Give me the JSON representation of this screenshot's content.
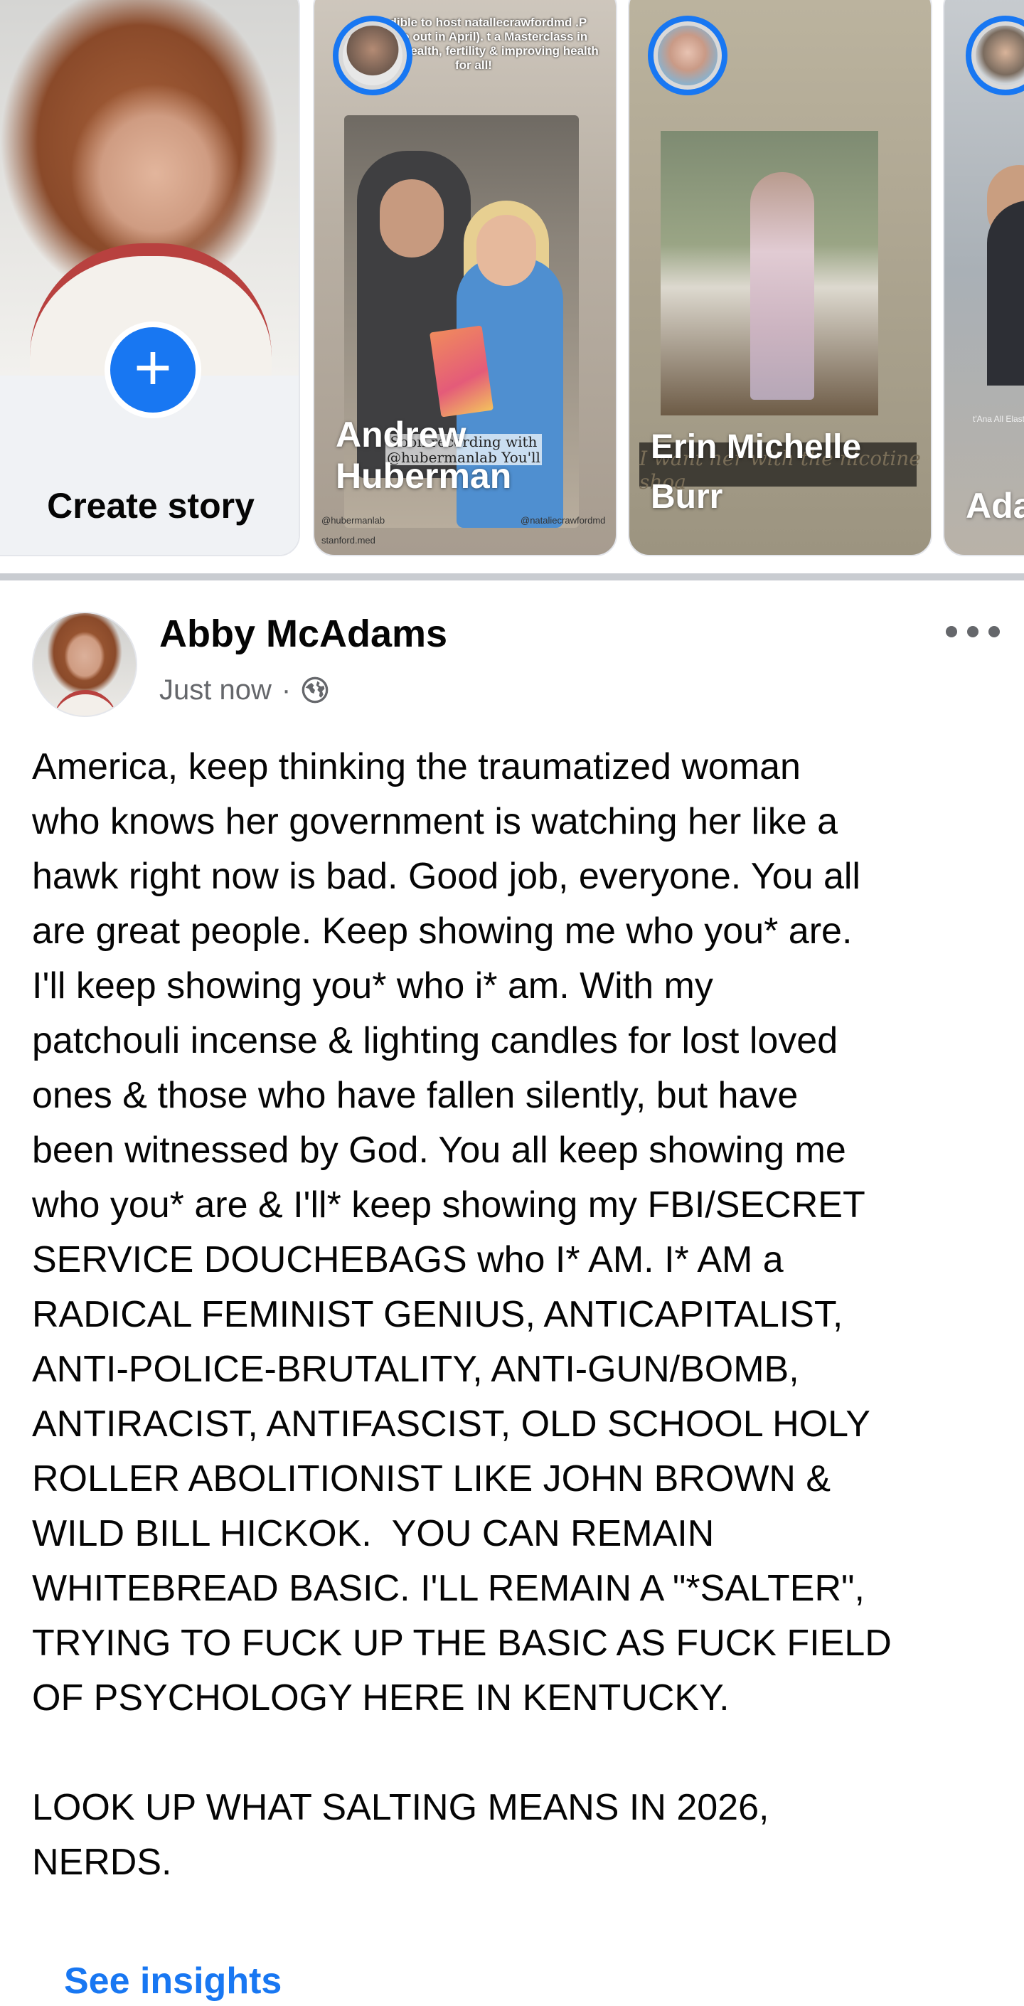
{
  "stories": {
    "create": {
      "label": "Create story",
      "icon": "plus-icon"
    },
    "items": [
      {
        "name": "Andrew Huberman",
        "caption": "Incredible to host natallecrawfordmd .P (episode out in April). t a Masterclass in women's health, fertility & improving health for all!",
        "overlay_text": "Soon recording with @hubermanlab",
        "overlay_text_2": "You'll",
        "handle_left": "@hubermanlab",
        "handle_right": "@nataliecrawfordmd",
        "handle_bottom": "stanford.med"
      },
      {
        "name": "Erin Michelle Burr",
        "mirror_text": "I want her with the nicotine shoa"
      },
      {
        "name": "Ada",
        "note": "t'Ana All Elasticy"
      }
    ]
  },
  "post": {
    "author": "Abby McAdams",
    "timestamp": "Just now",
    "separator": "·",
    "privacy_icon": "globe-icon",
    "more_icon": "more-options-icon",
    "lines": [
      "America, keep thinking the traumatized woman",
      "who knows her government is watching her like a",
      "hawk right now is bad. Good job, everyone. You all",
      "are great people. Keep showing me who you* are.",
      "I'll keep showing you* who i* am. With my",
      "patchouli incense & lighting candles for lost loved",
      "ones & those who have fallen silently, but have",
      "been witnessed by God. You all keep showing me",
      "who you* are & I'll* keep showing my FBI/SECRET",
      "SERVICE DOUCHEBAGS who I* AM. I* AM a",
      "RADICAL FEMINIST GENIUS, ANTICAPITALIST,",
      "ANTI-POLICE-BRUTALITY, ANTI-GUN/BOMB,",
      "ANTIRACIST, ANTIFASCIST, OLD SCHOOL HOLY",
      "ROLLER ABOLITIONIST LIKE JOHN BROWN &",
      "WILD BILL HICKOK.  YOU CAN REMAIN",
      "WHITEBREAD BASIC. I'LL REMAIN A \"*SALTER\",",
      "TRYING TO FUCK UP THE BASIC AS FUCK FIELD",
      "OF PSYCHOLOGY HERE IN KENTUCKY."
    ],
    "lines_2": [
      "LOOK UP WHAT SALTING MEANS IN 2026,",
      "NERDS."
    ],
    "insights_label": "See insights"
  },
  "colors": {
    "accent": "#1877f2",
    "meta": "#65676b",
    "text": "#050505"
  }
}
